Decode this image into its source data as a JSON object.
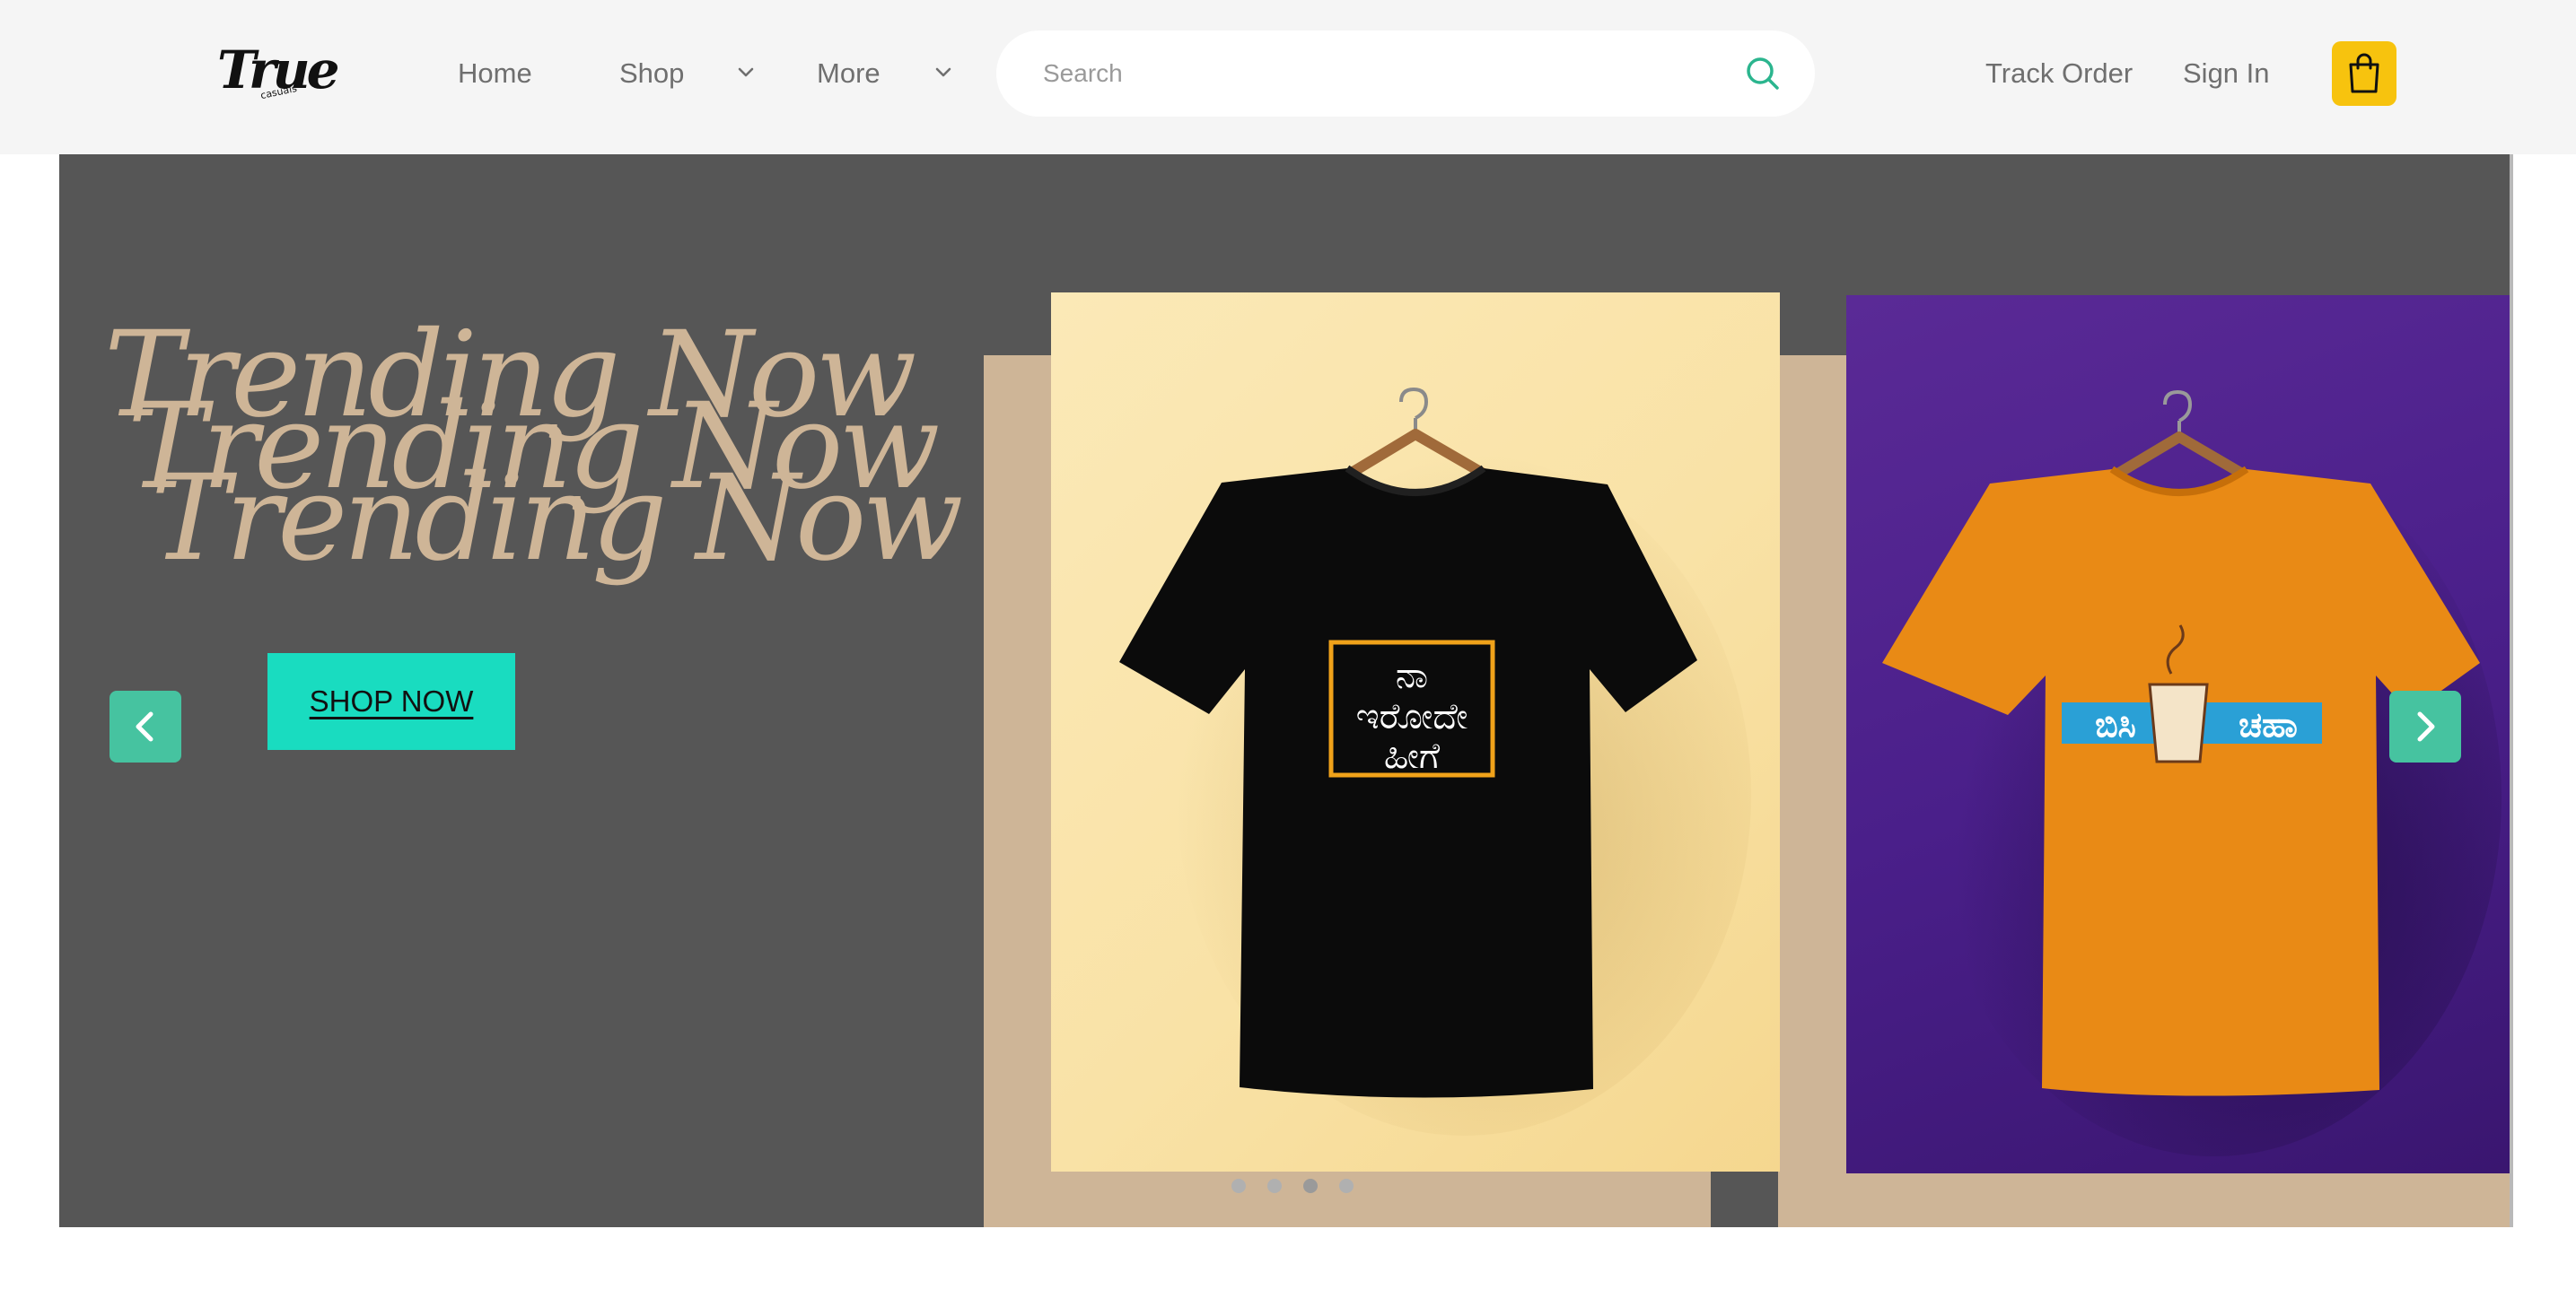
{
  "header": {
    "logo_text": "True",
    "logo_sub": "casuals",
    "nav": {
      "home": "Home",
      "shop": "Shop",
      "more": "More",
      "track_order": "Track Order",
      "sign_in": "Sign In"
    },
    "search": {
      "placeholder": "Search"
    },
    "icons": [
      "chevron-down-icon",
      "search-icon",
      "shopping-bag-icon"
    ]
  },
  "hero": {
    "headline_lines": [
      "Trending Now",
      "Trending Now",
      "Trending Now"
    ],
    "cta_label": "SHOP NOW",
    "slides": [
      {
        "shirt_color": "black",
        "print_text": "ನಾ ಇರೋದೇ ಹೀಗೆ"
      },
      {
        "shirt_color": "orange",
        "print_text": "ಬಿಸಿ ಚಹಾ"
      }
    ],
    "carousel": {
      "slide_count": 4,
      "active_index": 2
    }
  },
  "colors": {
    "accent": "#19dcc0",
    "arrow": "#46c3a0",
    "cart": "#f7c30e",
    "hero_bg": "#565656",
    "headline": "#ceb597"
  }
}
